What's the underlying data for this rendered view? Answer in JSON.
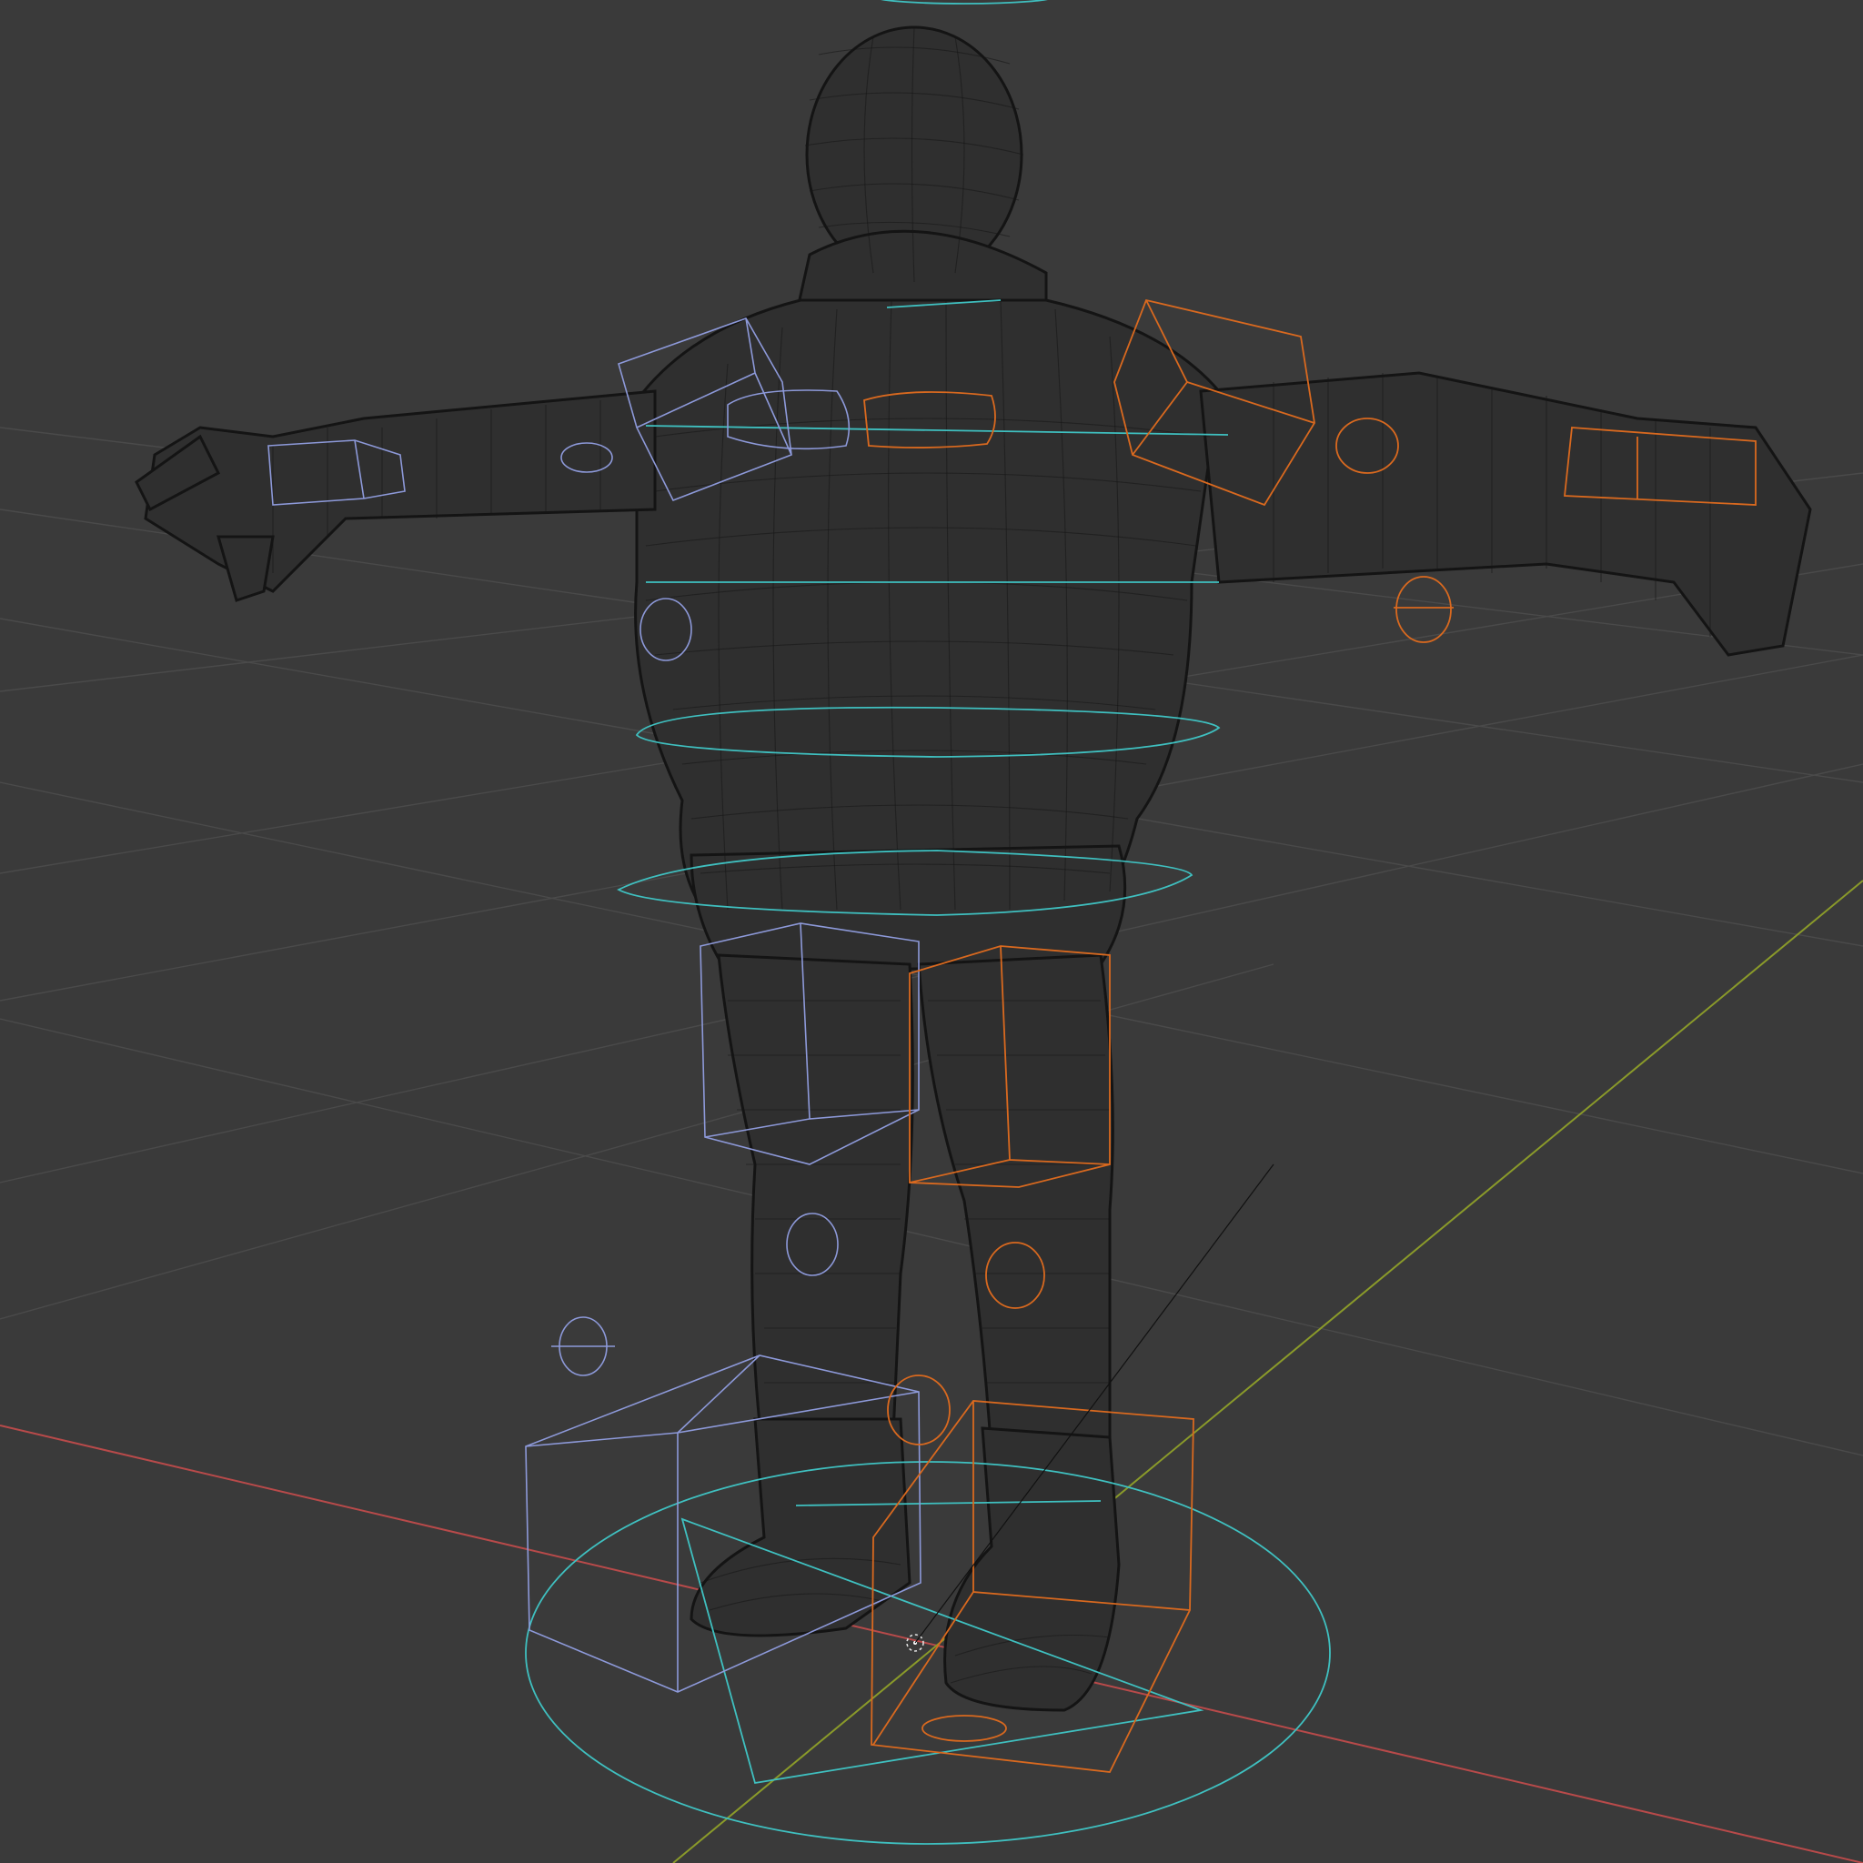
{
  "viewport": {
    "mode": "wireframe",
    "background_color": "#3a3a3a",
    "grid_color": "#4a4a4a",
    "x_axis_color": "#b84a4a",
    "y_axis_color": "#8a9a2a"
  },
  "rig": {
    "left_side_color": "#8d99d9",
    "right_side_color": "#d9691f",
    "center_color": "#3fc0c0"
  }
}
